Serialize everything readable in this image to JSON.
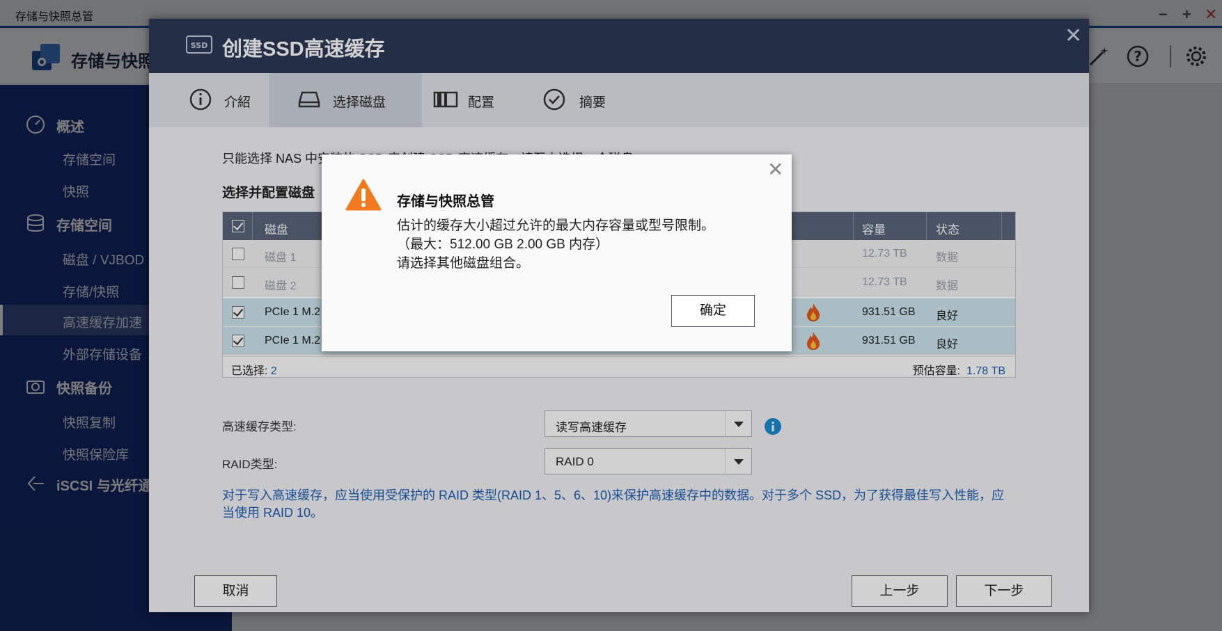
{
  "app": {
    "window_title": "存储与快照总管",
    "name": "存储与快照"
  },
  "sidebar": {
    "sections": [
      {
        "label": "概述",
        "icon": "gauge-icon",
        "items": [
          "存储空间",
          "快照"
        ]
      },
      {
        "label": "存储空间",
        "icon": "database-icon",
        "items": [
          "磁盘 / VJBOD",
          "存储/快照",
          "高速缓存加速",
          "外部存储设备"
        ],
        "active": "高速缓存加速"
      },
      {
        "label": "快照备份",
        "icon": "camera-icon",
        "items": [
          "快照复制",
          "快照保险库"
        ]
      },
      {
        "label": "iSCSI 与光纤通",
        "icon": "iscsi-icon",
        "items": []
      }
    ]
  },
  "wizard": {
    "title": "创建SSD高速缓存",
    "steps": [
      {
        "label": "介紹",
        "icon": "info-circle-icon"
      },
      {
        "label": "选择磁盘",
        "icon": "disk-drive-icon"
      },
      {
        "label": "配置",
        "icon": "config-icon"
      },
      {
        "label": "摘要",
        "icon": "check-circle-icon"
      }
    ],
    "intro_text": "只能选择 NAS 中安装的 SSD 来创建 SSD 高速缓存。请至少选择一个磁盘。",
    "section_title": "选择并配置磁盘",
    "table": {
      "headers": {
        "disk": "磁盘",
        "capacity": "容量",
        "status": "状态"
      },
      "rows": [
        {
          "disk": "磁盘 1",
          "capacity": "12.73 TB",
          "status": "数据",
          "checked": false,
          "disabled": true
        },
        {
          "disk": "磁盘 2",
          "capacity": "12.73 TB",
          "status": "数据",
          "checked": false,
          "disabled": true
        },
        {
          "disk": "PCIe 1 M.2",
          "capacity": "931.51 GB",
          "status": "良好",
          "checked": true,
          "disabled": false
        },
        {
          "disk": "PCIe 1 M.2",
          "capacity": "931.51 GB",
          "status": "良好",
          "checked": true,
          "disabled": false
        }
      ],
      "selected_label": "已选择:",
      "selected_count": "2",
      "estimated_label": "预估容量:",
      "estimated_value": "1.78 TB"
    },
    "cache_type_label": "高速缓存类型:",
    "cache_type_value": "读写高速缓存",
    "raid_type_label": "RAID类型:",
    "raid_type_value": "RAID 0",
    "raid_note": "对于写入高速缓存，应当使用受保护的 RAID 类型(RAID 1、5、6、10)来保护高速缓存中的数据。对于多个 SSD，为了获得最佳写入性能，应当使用 RAID 10。",
    "buttons": {
      "cancel": "取消",
      "back": "上一步",
      "next": "下一步"
    }
  },
  "alert": {
    "title": "存储与快照总管",
    "line1": "估计的缓存大小超过允许的最大内存容量或型号限制。",
    "line2": "（最大：512.00 GB 2.00 GB 内存）",
    "line3": "请选择其他磁盘组合。",
    "ok_label": "确定"
  },
  "colors": {
    "sidebar_bg": "#17307a",
    "wizard_header_bg": "#2c3a57",
    "accent_blue": "#1b5fb5",
    "selected_row": "#cde7ef",
    "warning_orange": "#f07a1d"
  }
}
